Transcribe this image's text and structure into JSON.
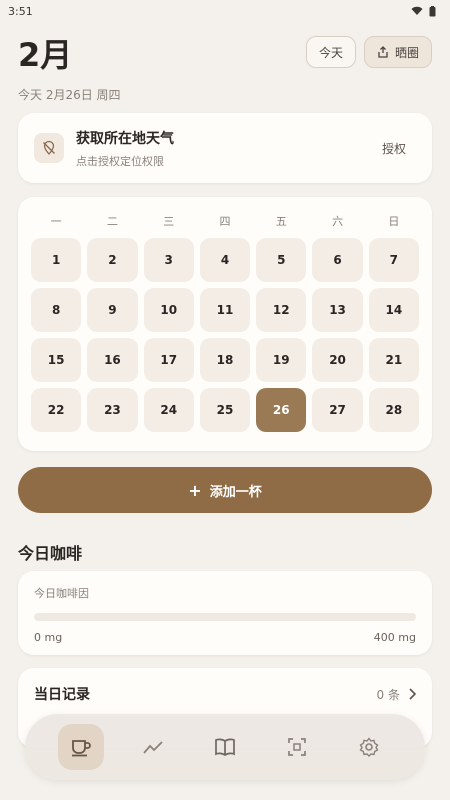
{
  "status": {
    "time": "3:51"
  },
  "header": {
    "month": "2月",
    "subdate": "今天 2月26日 周四",
    "today_btn": "今天",
    "share_btn": "晒圈"
  },
  "weather": {
    "title": "获取所在地天气",
    "subtitle": "点击授权定位权限",
    "action": "授权"
  },
  "calendar": {
    "weekdays": [
      "一",
      "二",
      "三",
      "四",
      "五",
      "六",
      "日"
    ],
    "days": [
      "1",
      "2",
      "3",
      "4",
      "5",
      "6",
      "7",
      "8",
      "9",
      "10",
      "11",
      "12",
      "13",
      "14",
      "15",
      "16",
      "17",
      "18",
      "19",
      "20",
      "21",
      "22",
      "23",
      "24",
      "25",
      "26",
      "27",
      "28"
    ],
    "today": "26"
  },
  "add_button": {
    "label": "添加一杯"
  },
  "coffee": {
    "section_title": "今日咖啡",
    "caffeine_label": "今日咖啡因",
    "current": "0 mg",
    "max": "400 mg",
    "progress": 0
  },
  "record": {
    "title": "当日记录",
    "count": "0 条"
  },
  "nav": {
    "items": [
      "coffee-cup-icon",
      "trend-icon",
      "book-icon",
      "scan-icon",
      "settings-icon"
    ],
    "active": 0
  },
  "colors": {
    "accent": "#8f6c46",
    "background": "#f4f1ec",
    "card": "#fffdfa"
  }
}
